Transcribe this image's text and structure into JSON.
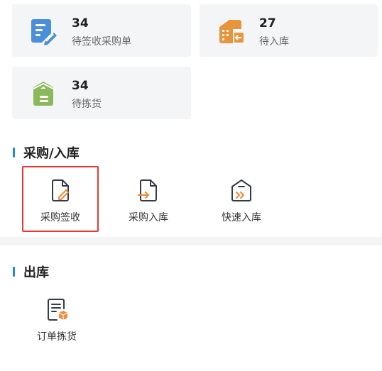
{
  "stats": [
    {
      "count": "34",
      "label": "待签收采购单",
      "icon": "document-edit-icon",
      "color": "#4a90d9"
    },
    {
      "count": "27",
      "label": "待入库",
      "icon": "warehouse-inbound-icon",
      "color": "#e8943a"
    },
    {
      "count": "34",
      "label": "待拣货",
      "icon": "picking-box-icon",
      "color": "#8cb85c"
    }
  ],
  "sections": {
    "purchase": {
      "title": "采购/入库",
      "items": [
        {
          "label": "采购签收",
          "icon": "purchase-sign-icon"
        },
        {
          "label": "采购入库",
          "icon": "purchase-inbound-icon"
        },
        {
          "label": "快速入库",
          "icon": "quick-inbound-icon"
        }
      ]
    },
    "outbound": {
      "title": "出库",
      "items": [
        {
          "label": "订单拣货",
          "icon": "order-picking-icon"
        }
      ]
    }
  },
  "colors": {
    "accent": "#1e88e5",
    "icon_outline": "#333a48",
    "icon_accent": "#f08c3c",
    "highlight": "#e53935"
  }
}
